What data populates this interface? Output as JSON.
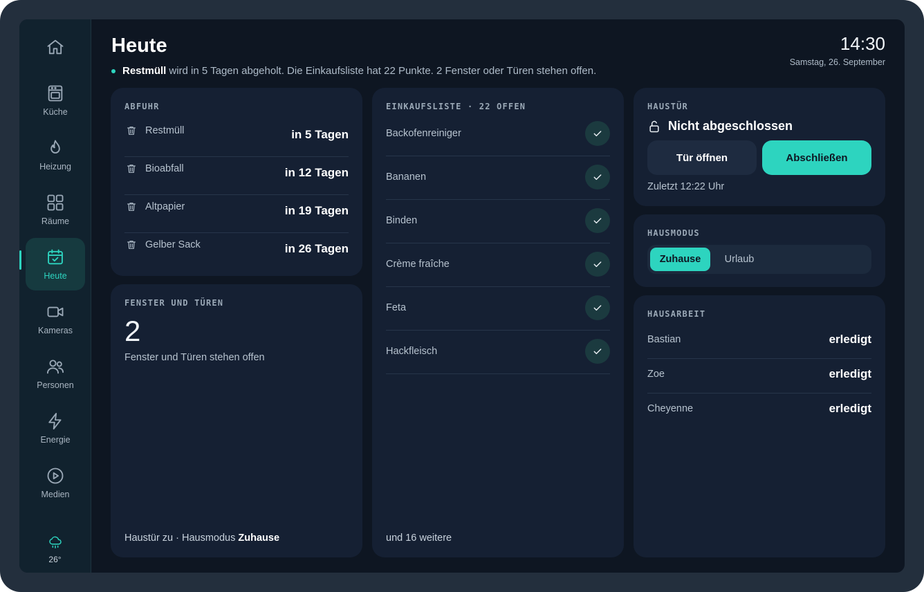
{
  "nav": {
    "items": [
      {
        "label": "",
        "icon": "home-icon"
      },
      {
        "label": "Küche",
        "icon": "oven-icon"
      },
      {
        "label": "Heizung",
        "icon": "flame-icon"
      },
      {
        "label": "Räume",
        "icon": "grid-icon"
      },
      {
        "label": "Heute",
        "icon": "calendar-check-icon",
        "active": true
      },
      {
        "label": "Kameras",
        "icon": "video-icon"
      },
      {
        "label": "Personen",
        "icon": "users-icon"
      },
      {
        "label": "Energie",
        "icon": "bolt-icon"
      },
      {
        "label": "Medien",
        "icon": "play-icon"
      }
    ],
    "weather": {
      "temp": "26°",
      "icon": "rain-cloud-icon"
    }
  },
  "header": {
    "title": "Heute",
    "summary_bold": "Restmüll",
    "summary_rest": "wird in 5 Tagen abgeholt. Die Einkaufsliste hat 22 Punkte. 2 Fenster oder Türen stehen offen.",
    "time": "14:30",
    "date": "Samstag, 26. September"
  },
  "abfuhr": {
    "heading": "ABFUHR",
    "items": [
      {
        "name": "Restmüll",
        "when": "in 5 Tagen"
      },
      {
        "name": "Bioabfall",
        "when": "in 12 Tagen"
      },
      {
        "name": "Altpapier",
        "when": "in 19 Tagen"
      },
      {
        "name": "Gelber Sack",
        "when": "in 26 Tagen"
      }
    ]
  },
  "fenster": {
    "heading": "FENSTER UND TÜREN",
    "count": "2",
    "text": "Fenster und Türen stehen offen",
    "footer_prefix": "Haustür zu · Hausmodus",
    "footer_mode": "Zuhause"
  },
  "einkauf": {
    "heading": "EINKAUFSLISTE · 22 OFFEN",
    "items": [
      "Backofenreiniger",
      "Bananen",
      "Binden",
      "Crème fraîche",
      "Feta",
      "Hackfleisch"
    ],
    "more": "und 16 weitere"
  },
  "haustuer": {
    "heading": "HAUSTÜR",
    "status": "Nicht abgeschlossen",
    "open_label": "Tür öffnen",
    "lock_label": "Abschließen",
    "last": "Zuletzt 12:22 Uhr"
  },
  "hausmodus": {
    "heading": "HAUSMODUS",
    "options": [
      "Zuhause",
      "Urlaub"
    ],
    "selected": "Zuhause"
  },
  "hausarbeit": {
    "heading": "HAUSARBEIT",
    "items": [
      {
        "name": "Bastian",
        "status": "erledigt"
      },
      {
        "name": "Zoe",
        "status": "erledigt"
      },
      {
        "name": "Cheyenne",
        "status": "erledigt"
      }
    ]
  },
  "colors": {
    "accent": "#2dd4bf",
    "background": "#0e1622",
    "card": "#152033"
  }
}
